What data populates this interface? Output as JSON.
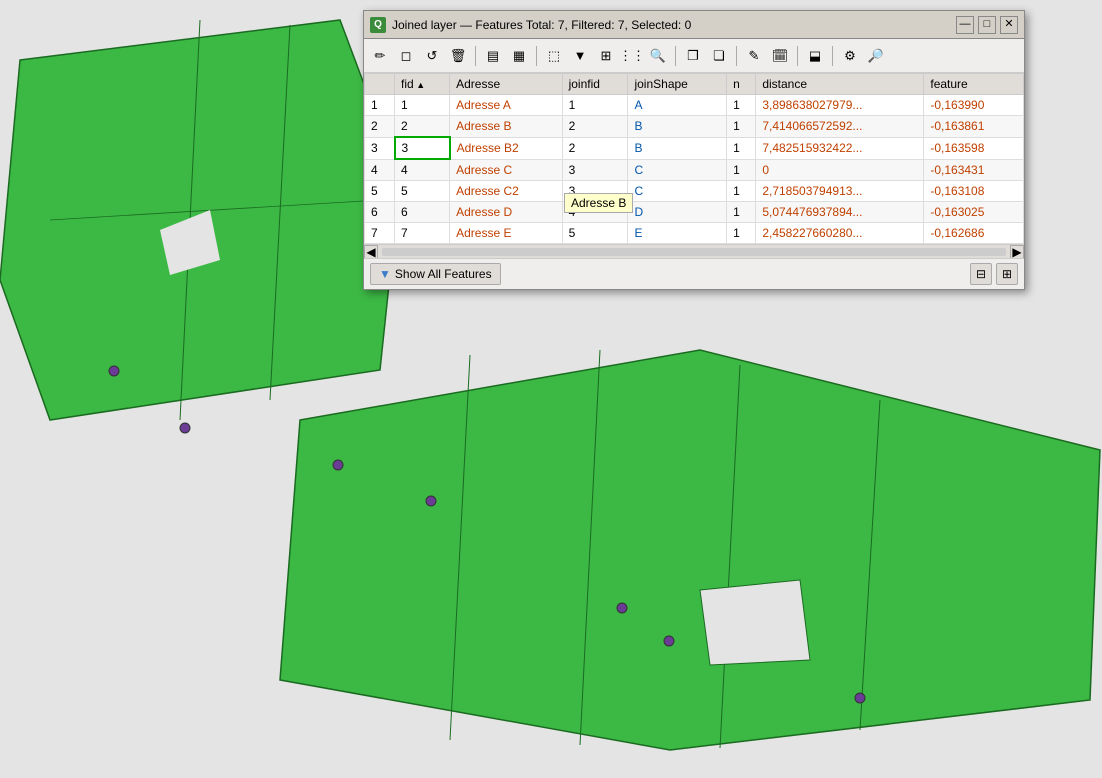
{
  "map": {
    "bg_color": "#e4e4e4"
  },
  "window": {
    "title": "Joined layer — Features Total: 7, Filtered: 7, Selected: 0",
    "icon_label": "Q",
    "min_btn": "—",
    "max_btn": "□",
    "close_btn": "✕"
  },
  "toolbar": {
    "buttons": [
      {
        "id": "pencil",
        "icon": "✏",
        "label": "pencil-icon"
      },
      {
        "id": "select",
        "icon": "◻",
        "label": "select-icon"
      },
      {
        "id": "reload",
        "icon": "↺",
        "label": "reload-icon"
      },
      {
        "id": "delete",
        "icon": "🗑",
        "label": "delete-icon"
      },
      {
        "id": "sep1",
        "sep": true
      },
      {
        "id": "table1",
        "icon": "▤",
        "label": "table1-icon"
      },
      {
        "id": "table2",
        "icon": "▦",
        "label": "table2-icon"
      },
      {
        "id": "sep2",
        "sep": true
      },
      {
        "id": "select2",
        "icon": "⬚",
        "label": "select2-icon"
      },
      {
        "id": "filter",
        "icon": "▼",
        "label": "filter-icon"
      },
      {
        "id": "table3",
        "icon": "⊞",
        "label": "table3-icon"
      },
      {
        "id": "grid",
        "icon": "⋮⋮",
        "label": "grid-icon"
      },
      {
        "id": "zoom",
        "icon": "🔍",
        "label": "zoom-icon"
      },
      {
        "id": "sep3",
        "sep": true
      },
      {
        "id": "copy1",
        "icon": "❐",
        "label": "copy1-icon"
      },
      {
        "id": "copy2",
        "icon": "❏",
        "label": "copy2-icon"
      },
      {
        "id": "sep4",
        "sep": true
      },
      {
        "id": "edit1",
        "icon": "✎",
        "label": "edit1-icon"
      },
      {
        "id": "calc",
        "icon": "🗓",
        "label": "calc-icon"
      },
      {
        "id": "sep5",
        "sep": true
      },
      {
        "id": "copy3",
        "icon": "⬓",
        "label": "copy3-icon"
      },
      {
        "id": "sep6",
        "sep": true
      },
      {
        "id": "settings",
        "icon": "⚙",
        "label": "settings-icon"
      },
      {
        "id": "search2",
        "icon": "🔎",
        "label": "search2-icon"
      }
    ]
  },
  "table": {
    "columns": [
      {
        "id": "fid",
        "label": "fid",
        "sort": "asc"
      },
      {
        "id": "adresse",
        "label": "Adresse",
        "sort": "none"
      },
      {
        "id": "joinfid",
        "label": "joinfid",
        "sort": "none"
      },
      {
        "id": "joinshape",
        "label": "joinShape",
        "sort": "none"
      },
      {
        "id": "n",
        "label": "n",
        "sort": "none"
      },
      {
        "id": "distance",
        "label": "distance",
        "sort": "none"
      },
      {
        "id": "feature",
        "label": "feature",
        "sort": "none"
      }
    ],
    "rows": [
      {
        "row": "1",
        "fid": "1",
        "adresse": "Adresse A",
        "joinfid": "1",
        "joinshape": "A",
        "n": "1",
        "distance": "3,898638027979...",
        "feature": "-0,163990",
        "active": false
      },
      {
        "row": "2",
        "fid": "2",
        "adresse": "Adresse B",
        "joinfid": "2",
        "joinshape": "B",
        "n": "1",
        "distance": "7,414066572592...",
        "feature": "-0,163861",
        "active": false
      },
      {
        "row": "3",
        "fid": "3",
        "adresse": "Adresse B2",
        "joinfid": "2",
        "joinshape": "B",
        "n": "1",
        "distance": "7,482515932422...",
        "feature": "-0,163598",
        "active": true
      },
      {
        "row": "4",
        "fid": "4",
        "adresse": "Adresse C",
        "joinfid": "3",
        "joinshape": "C",
        "n": "1",
        "distance": "0",
        "feature": "-0,163431",
        "active": false
      },
      {
        "row": "5",
        "fid": "5",
        "adresse": "Adresse C2",
        "joinfid": "3",
        "joinshape": "C",
        "n": "1",
        "distance": "2,718503794913...",
        "feature": "-0,163108",
        "active": false
      },
      {
        "row": "6",
        "fid": "6",
        "adresse": "Adresse D",
        "joinfid": "4",
        "joinshape": "D",
        "n": "1",
        "distance": "5,074476937894...",
        "feature": "-0,163025",
        "active": false
      },
      {
        "row": "7",
        "fid": "7",
        "adresse": "Adresse E",
        "joinfid": "5",
        "joinshape": "E",
        "n": "1",
        "distance": "2,458227660280...",
        "feature": "-0,162686",
        "active": false
      }
    ]
  },
  "tooltip": {
    "text": "Adresse B",
    "visible": true
  },
  "footer": {
    "show_all_label": "Show All Features",
    "filter_icon": "▼"
  }
}
